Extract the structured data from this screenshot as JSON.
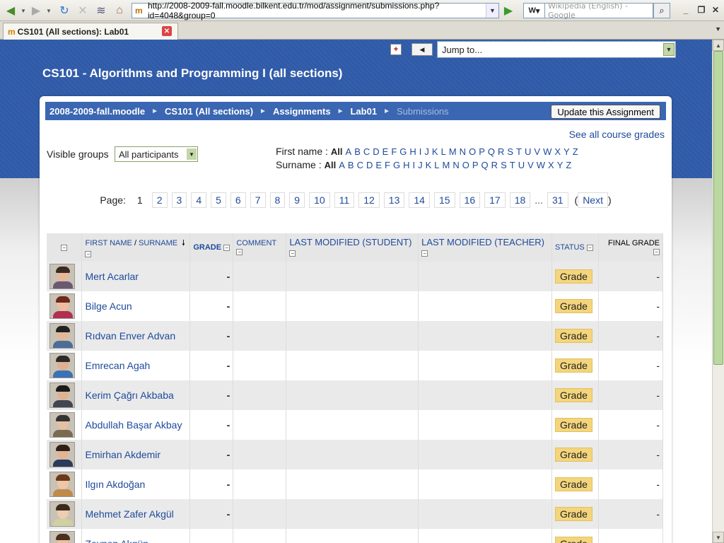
{
  "browser": {
    "url": "http://2008-2009-fall.moodle.bilkent.edu.tr/mod/assignment/submissions.php?id=4048&group=0",
    "search_engine_label": "W",
    "search_placeholder": "Wikipedia (English) - Google",
    "tab_title": "CS101 (All sections): Lab01",
    "tab_icon": "moodle-icon"
  },
  "header": {
    "jump_to": "Jump to...",
    "course_title": "CS101 - Algorithms and Programming I (all sections)"
  },
  "breadcrumb": {
    "items": [
      "2008-2009-fall.moodle",
      "CS101 (All sections)",
      "Assignments",
      "Lab01"
    ],
    "current": "Submissions",
    "separator": "►"
  },
  "update_button": "Update this Assignment",
  "see_all_grades": "See all course grades",
  "visible_groups": {
    "label": "Visible groups",
    "value": "All participants"
  },
  "initials": {
    "firstname_label": "First name :",
    "surname_label": "Surname :",
    "all_label": "All",
    "letters": [
      "A",
      "B",
      "C",
      "D",
      "E",
      "F",
      "G",
      "H",
      "I",
      "J",
      "K",
      "L",
      "M",
      "N",
      "O",
      "P",
      "Q",
      "R",
      "S",
      "T",
      "U",
      "V",
      "W",
      "X",
      "Y",
      "Z"
    ]
  },
  "pager": {
    "label": "Page:",
    "current": "1",
    "pages": [
      "2",
      "3",
      "4",
      "5",
      "6",
      "7",
      "8",
      "9",
      "10",
      "11",
      "12",
      "13",
      "14",
      "15",
      "16",
      "17",
      "18"
    ],
    "ellipsis": "...",
    "last": "31",
    "open_paren": "(",
    "next": "Next",
    "close_paren": ")"
  },
  "table": {
    "headers": {
      "firstname": "FIRST NAME",
      "slash": " / ",
      "surname": "SURNAME",
      "sort_icon": "sort-arrow-down-icon",
      "grade": "GRADE",
      "comment": "COMMENT",
      "modified_student": "LAST MODIFIED (STUDENT)",
      "modified_teacher": "LAST MODIFIED (TEACHER)",
      "status": "STATUS",
      "final_grade": "FINAL GRADE"
    },
    "rows": [
      {
        "name": "Mert Acarlar",
        "grade": "-",
        "status": "Grade",
        "final": "-"
      },
      {
        "name": "Bilge Acun",
        "grade": "-",
        "status": "Grade",
        "final": "-"
      },
      {
        "name": "Rıdvan Enver Advan",
        "grade": "-",
        "status": "Grade",
        "final": "-"
      },
      {
        "name": "Emrecan Agah",
        "grade": "-",
        "status": "Grade",
        "final": "-"
      },
      {
        "name": "Kerim Çağrı Akbaba",
        "grade": "-",
        "status": "Grade",
        "final": "-"
      },
      {
        "name": "Abdullah Başar Akbay",
        "grade": "-",
        "status": "Grade",
        "final": "-"
      },
      {
        "name": "Emirhan Akdemir",
        "grade": "-",
        "status": "Grade",
        "final": "-"
      },
      {
        "name": "Ilgın Akdoğan",
        "grade": "-",
        "status": "Grade",
        "final": "-"
      },
      {
        "name": "Mehmet Zafer Akgül",
        "grade": "-",
        "status": "Grade",
        "final": "-"
      },
      {
        "name": "Zeynep Akgün",
        "grade": "",
        "status": "Grade",
        "final": ""
      }
    ]
  },
  "colors": {
    "header_blue": "#2f5aa8",
    "breadcrumb_blue": "#3a66b2",
    "link": "#1d4a9c",
    "grade_button": "#f4d57c"
  }
}
